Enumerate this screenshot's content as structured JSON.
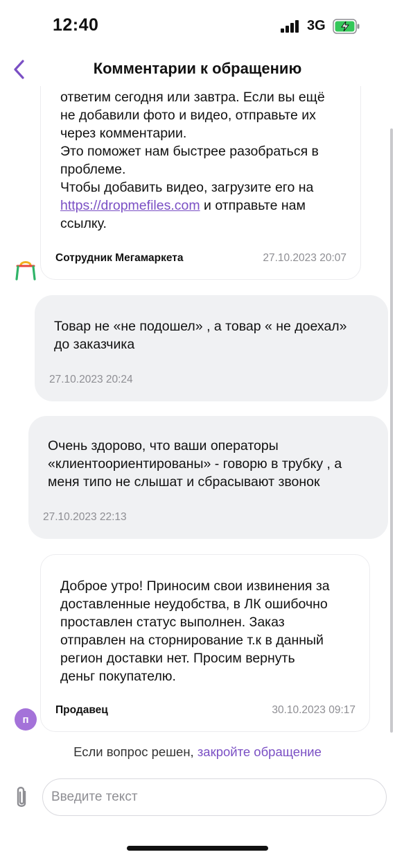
{
  "status_bar": {
    "time": "12:40",
    "network": "3G"
  },
  "header": {
    "title": "Комментарии к обращению"
  },
  "messages": [
    {
      "text_before_link": "ответим сегодня или завтра. Если вы ещё\nне добавили фото и видео, отправьте их\nчерез комментарии.\nЭто поможет нам быстрее разобраться в\nпроблеме.\nЧтобы добавить видео, загрузите его на\n",
      "link": "https://dropmefiles.com",
      "text_after_link": " и отправьте нам\nссылку.",
      "author": "Сотрудник Мегамаркета",
      "date": "27.10.2023 20:07"
    },
    {
      "text": "Товар не «не подошел» , а товар « не доехал»\nдо заказчика",
      "date": "27.10.2023 20:24"
    },
    {
      "text": "Очень здорово, что ваши операторы\n«клиентоориентированы» - говорю в трубку , а\nменя типо не слышат и сбрасывают звонок",
      "date": "27.10.2023 22:13"
    },
    {
      "text": "Доброе утро! Приносим свои извинения за\nдоставленные неудобства, в ЛК ошибочно\nпроставлен статус выполнен. Заказ\nотправлен на сторнирование т.к в данный\nрегион доставки нет. Просим вернуть\nденьг покупателю.",
      "author": "Продавец",
      "avatar_letter": "п",
      "date": "30.10.2023 09:17"
    }
  ],
  "resolve": {
    "prefix": "Если вопрос решен,",
    "link": "закройте обращение"
  },
  "composer": {
    "placeholder": "Введите текст"
  },
  "icons": {
    "back": "chevron-left-icon",
    "attach": "paperclip-icon",
    "logo": "megamarket-bag-icon"
  },
  "colors": {
    "accent": "#7a4fc4",
    "bubble": "#f0f1f3",
    "seller_avatar": "#a472d9"
  }
}
